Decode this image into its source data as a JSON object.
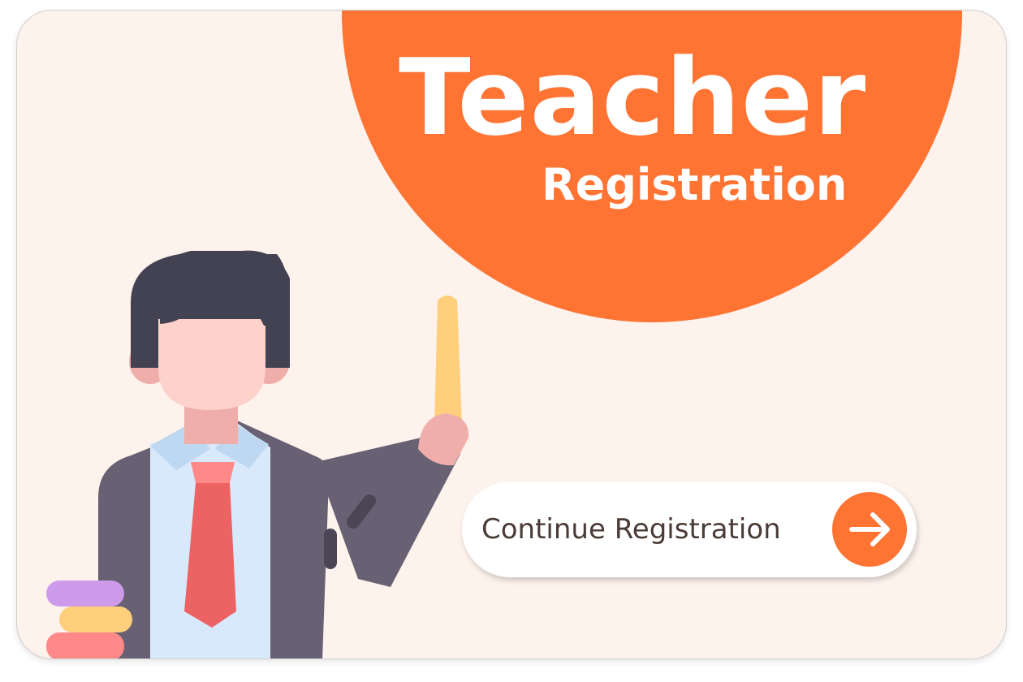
{
  "banner": {
    "title": "Teacher",
    "subtitle": "Registration"
  },
  "cta": {
    "label": "Continue Registration",
    "icon": "arrow-right-icon"
  },
  "illustration": {
    "subject": "teacher-illustration"
  },
  "colors": {
    "accent": "#ff7333",
    "background": "#fdf2ec",
    "text": "#4a3b36",
    "suit": "#686073",
    "hair": "#434252",
    "tie": "#ed6363",
    "chalk": "#ffcf7b"
  }
}
